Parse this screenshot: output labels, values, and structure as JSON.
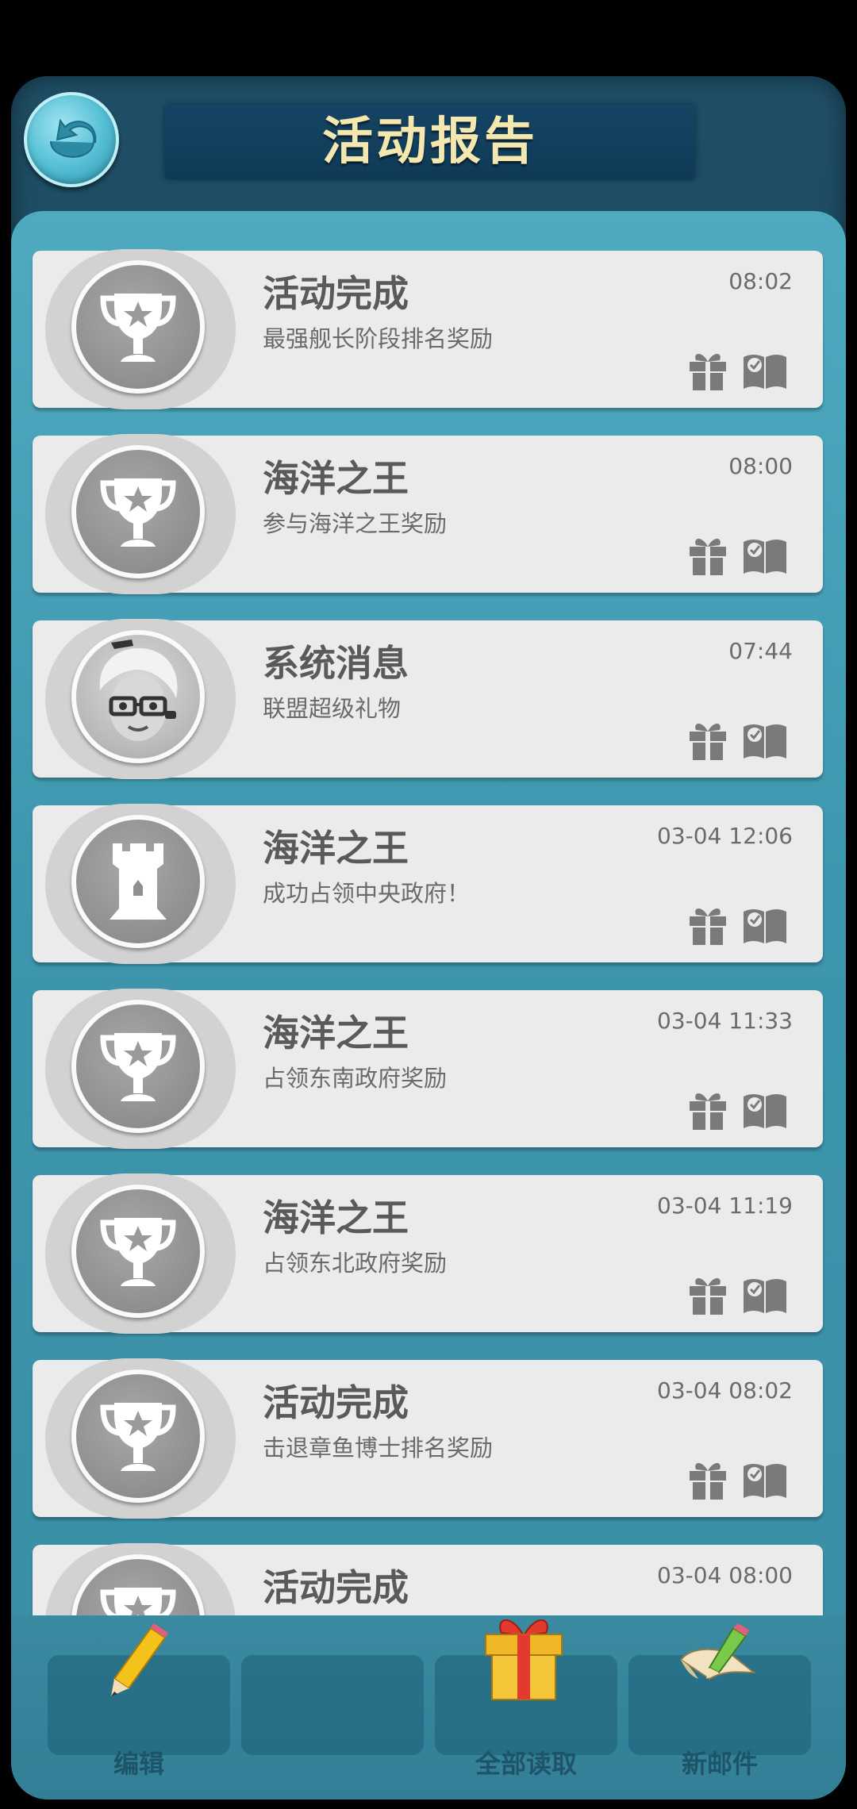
{
  "header": {
    "title": "活动报告"
  },
  "messages": [
    {
      "title": "活动完成",
      "desc": "最强舰长阶段排名奖励",
      "time": "08:02",
      "avatar": "trophy-icon"
    },
    {
      "title": "海洋之王",
      "desc": "参与海洋之王奖励",
      "time": "08:00",
      "avatar": "trophy-icon"
    },
    {
      "title": "系统消息",
      "desc": "联盟超级礼物",
      "time": "07:44",
      "avatar": "secretary-portrait"
    },
    {
      "title": "海洋之王",
      "desc": "成功占领中央政府！",
      "time": "03-04 12:06",
      "avatar": "tower-icon"
    },
    {
      "title": "海洋之王",
      "desc": "占领东南政府奖励",
      "time": "03-04 11:33",
      "avatar": "trophy-icon"
    },
    {
      "title": "海洋之王",
      "desc": "占领东北政府奖励",
      "time": "03-04 11:19",
      "avatar": "trophy-icon"
    },
    {
      "title": "活动完成",
      "desc": "击退章鱼博士排名奖励",
      "time": "03-04 08:02",
      "avatar": "trophy-icon"
    },
    {
      "title": "活动完成",
      "desc": "",
      "time": "03-04 08:00",
      "avatar": "trophy-icon"
    }
  ],
  "toolbar": {
    "edit_label": "编辑",
    "empty_label": "",
    "read_all_label": "全部读取",
    "new_mail_label": "新邮件"
  },
  "colors": {
    "frame": "#1f4f66",
    "content": "#4fa9bf",
    "card": "#ebebeb",
    "title_text": "#f4e7b0"
  }
}
